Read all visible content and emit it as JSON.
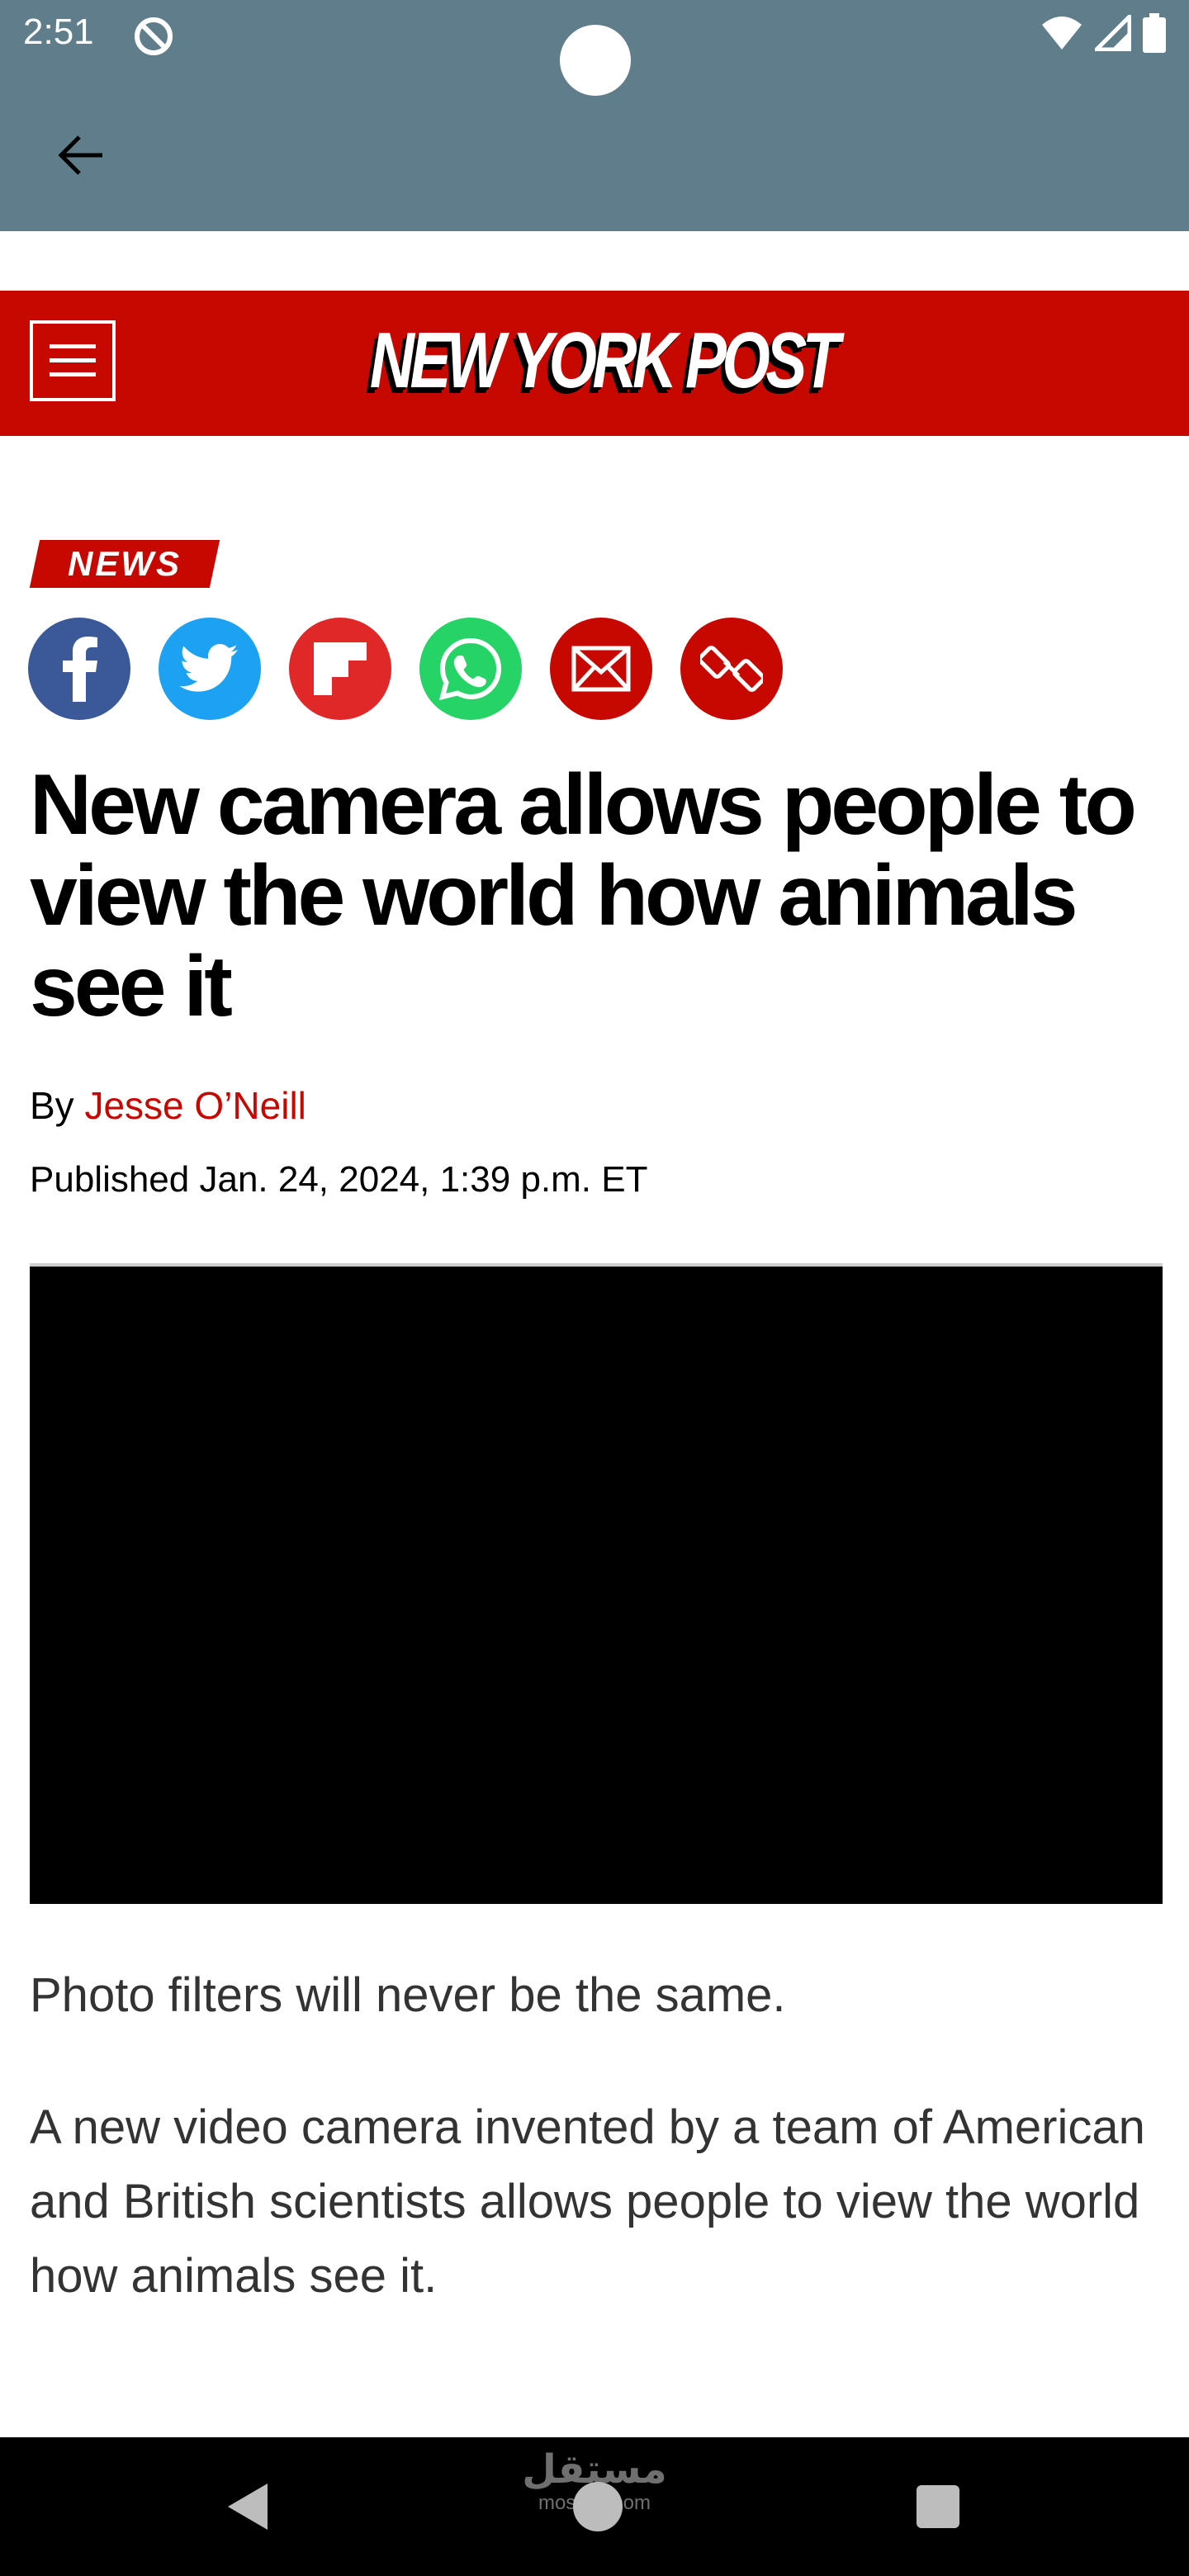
{
  "status_bar": {
    "time": "2:51",
    "icons": [
      "app-notification-icon",
      "wifi-icon",
      "cell-signal-icon",
      "battery-icon"
    ]
  },
  "app_bar": {
    "back_icon": "arrow-left-icon"
  },
  "masthead": {
    "logo_text": "NEW YORK POST",
    "menu_icon": "hamburger-menu-icon",
    "background_color": "#c60800"
  },
  "article": {
    "section": "NEWS",
    "share_buttons": [
      {
        "name": "facebook-share-icon",
        "color": "#3b5998"
      },
      {
        "name": "twitter-share-icon",
        "color": "#1da1f2"
      },
      {
        "name": "flipboard-share-icon",
        "color": "#e12828"
      },
      {
        "name": "whatsapp-share-icon",
        "color": "#25d366"
      },
      {
        "name": "email-share-icon",
        "color": "#c60800"
      },
      {
        "name": "copy-link-icon",
        "color": "#c60800"
      }
    ],
    "headline": "New camera allows people to view the world how animals see it",
    "byline_prefix": "By ",
    "author": "Jesse O’Neill",
    "published": "Published Jan. 24, 2024, 1:39 p.m. ET",
    "paragraphs": [
      "Photo filters will never be the same.",
      "A new video camera invented by a team of American and British scientists allows people to view the world how animals see it."
    ]
  },
  "nav_bar": {
    "watermark_main": "مستقل",
    "watermark_sub": "mostaql.com"
  }
}
